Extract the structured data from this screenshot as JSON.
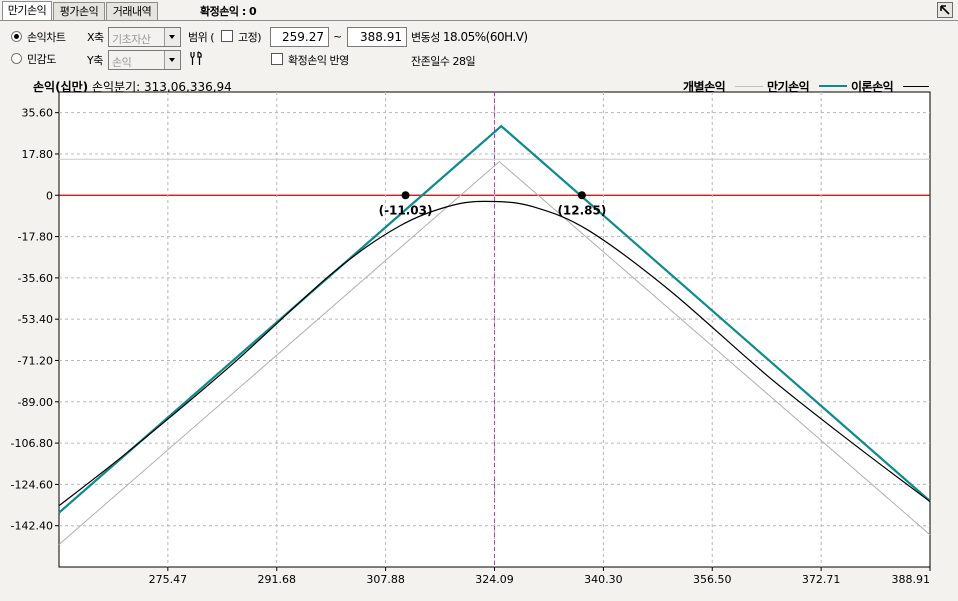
{
  "tabs": [
    {
      "label": "만기손익",
      "active": true
    },
    {
      "label": "평가손익",
      "active": false
    },
    {
      "label": "거래내역",
      "active": false
    }
  ],
  "confirmed_pnl": {
    "label": "확정손익",
    "value": "0"
  },
  "controls": {
    "radio_pnl_chart": "손익차트",
    "radio_sensitivity": "민감도",
    "x_axis_label": "X축",
    "x_axis_value": "기초자산",
    "y_axis_label": "Y축",
    "y_axis_value": "손익",
    "range_label": "범위 (",
    "fixed_label": "고정)",
    "range_min": "259.27",
    "range_tilde": "~",
    "range_max": "388.91",
    "volatility_label": "변동성",
    "volatility_value": "18.05%(60H.V)",
    "apply_confirmed_label": "확정손익 반영",
    "days_left_label": "잔존일수",
    "days_left_value": "28일"
  },
  "chart_header": {
    "title": "손익(십만)",
    "breakeven_label": "손익분기:",
    "breakeven_value": "313,06,336,94"
  },
  "legend": [
    {
      "label": "개별손익",
      "color": "#c0c0c0"
    },
    {
      "label": "만기손익",
      "color": "#0e8a8c"
    },
    {
      "label": "이론손익",
      "color": "#000000"
    }
  ],
  "chart_data": {
    "type": "line",
    "xlim": [
      259.27,
      388.91
    ],
    "ylim": [
      -160.2,
      44.5
    ],
    "x_ticks": [
      "275.47",
      "291.68",
      "307.88",
      "324.09",
      "340.30",
      "356.50",
      "372.71",
      "388.91"
    ],
    "x_tick_values": [
      275.47,
      291.68,
      307.88,
      324.09,
      340.3,
      356.5,
      372.71,
      388.91
    ],
    "y_ticks": [
      "35.60",
      "17.80",
      "0",
      "-17.80",
      "-35.60",
      "-53.40",
      "-71.20",
      "-89.00",
      "-106.80",
      "-124.60",
      "-142.40"
    ],
    "y_tick_values": [
      35.6,
      17.8,
      0,
      -17.8,
      -35.6,
      -53.4,
      -71.2,
      -89.0,
      -106.8,
      -124.6,
      -142.4
    ],
    "grid": true,
    "zero_line_color": "#cc0000",
    "current_price": 324.09,
    "current_price_color": "#cc33cc",
    "reference_level": 15.5,
    "series": [
      {
        "name": "개별손익",
        "color": "#b0b0b0",
        "x": [
          259.27,
          324.8,
          388.91
        ],
        "y": [
          -150.5,
          14.5,
          -146.3
        ]
      },
      {
        "name": "만기손익",
        "color": "#0e8a8c",
        "x": [
          259.27,
          325.1,
          388.91
        ],
        "y": [
          -136.8,
          29.8,
          -131.8
        ]
      },
      {
        "name": "이론손익",
        "color": "#000000",
        "x": [
          259.27,
          270,
          285,
          300,
          310,
          318,
          324.09,
          330,
          338,
          350,
          365,
          378,
          388.91
        ],
        "y": [
          -133.8,
          -109.5,
          -73.0,
          -33.5,
          -13.2,
          -4.2,
          -2.7,
          -5.1,
          -15.0,
          -40.6,
          -78.5,
          -108.2,
          -132.0
        ]
      }
    ],
    "annotations": [
      {
        "text": "(-11.03)",
        "x": 310.85,
        "y": 0
      },
      {
        "text": "(12.85)",
        "x": 337.1,
        "y": 0
      }
    ]
  }
}
